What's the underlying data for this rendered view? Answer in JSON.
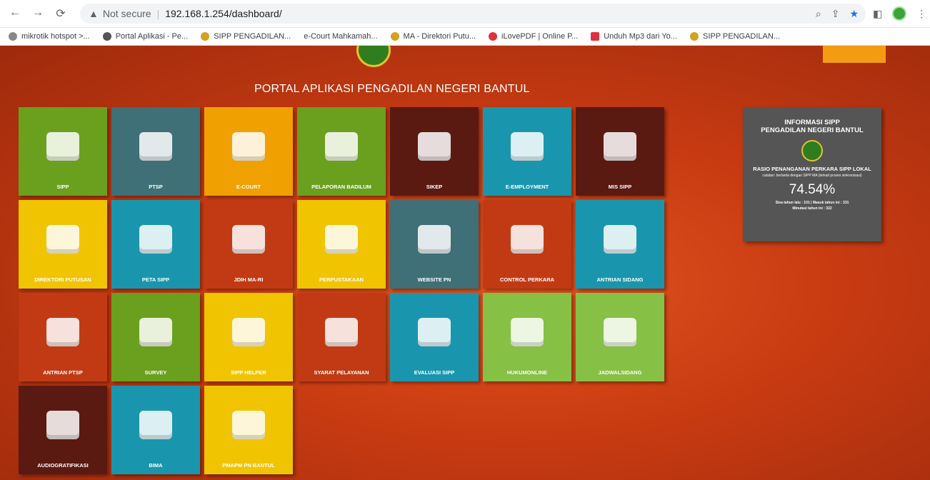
{
  "browser": {
    "security_label": "Not secure",
    "url": "192.168.1.254/dashboard/",
    "bookmarks": [
      "mikrotik hotspot >...",
      "Portal Aplikasi - Pe...",
      "SIPP PENGADILAN...",
      "e-Court Mahkamah...",
      "MA - Direktori Putu...",
      "iLovePDF | Online P...",
      "Unduh Mp3 dari Yo...",
      "SIPP PENGADILAN..."
    ]
  },
  "portal": {
    "title": "PORTAL APLIKASI PENGADILAN NEGERI BANTUL"
  },
  "tiles": [
    {
      "label": "SIPP",
      "color": "#6aa01e"
    },
    {
      "label": "PTSP",
      "color": "#3f6f77"
    },
    {
      "label": "E-COURT",
      "color": "#f0a000"
    },
    {
      "label": "PELAPORAN BADILUM",
      "color": "#6aa01e"
    },
    {
      "label": "SIKEP",
      "color": "#5a1a12"
    },
    {
      "label": "E-EMPLOYMENT",
      "color": "#1996ad"
    },
    {
      "label": "MIS SIPP",
      "color": "#5a1a12"
    },
    {
      "label": "DIREKTORI PUTUSAN",
      "color": "#f0c400"
    },
    {
      "label": "PETA SIPP",
      "color": "#1996ad"
    },
    {
      "label": "JDIH MA-RI",
      "color": "#c23a14"
    },
    {
      "label": "PERPUSTAKAAN",
      "color": "#f0c400"
    },
    {
      "label": "WEBSITE PN",
      "color": "#3f6f77"
    },
    {
      "label": "CONTROL PERKARA",
      "color": "#c23a14"
    },
    {
      "label": "ANTRIAN SIDANG",
      "color": "#1996ad"
    },
    {
      "label": "ANTRIAN PTSP",
      "color": "#c23a14"
    },
    {
      "label": "SURVEY",
      "color": "#6aa01e"
    },
    {
      "label": "SIPP HELPER",
      "color": "#f0c400"
    },
    {
      "label": "SYARAT PELAYANAN",
      "color": "#c23a14"
    },
    {
      "label": "EVALUASI SIPP",
      "color": "#1996ad"
    },
    {
      "label": "HUKUMONLINE",
      "color": "#86c045"
    },
    {
      "label": "JADWALSIDANG",
      "color": "#86c045"
    },
    {
      "label": "AUDIOGRATIFIKASI",
      "color": "#5a1a12"
    },
    {
      "label": "BIMA",
      "color": "#1996ad"
    },
    {
      "label": "PMAPM PN BANTUL",
      "color": "#f0c400"
    }
  ],
  "info_panel": {
    "title1": "INFORMASI SIPP",
    "title2": "PENGADILAN NEGERI BANTUL",
    "ratio_label": "RASIO PENANGANAN PERKARA SIPP LOKAL",
    "note": "catatan: berbeda dengan SIPP MA (terkait proses sinkronisasi)",
    "percent": "74.54%",
    "stats": "Sisa tahun lalu : 101 | Masuk tahun ini : 331",
    "minutasi": "Minutasi tahun ini : 322"
  }
}
